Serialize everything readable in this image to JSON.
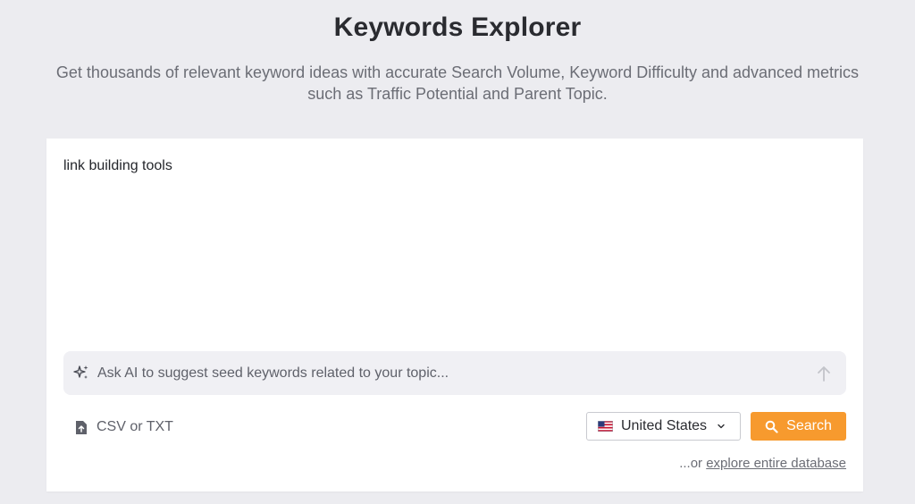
{
  "header": {
    "title": "Keywords Explorer",
    "subtitle": "Get thousands of relevant keyword ideas with accurate Search Volume, Keyword Difficulty and advanced metrics such as Traffic Potential and Parent Topic."
  },
  "keyword_input": {
    "value": "link building tools"
  },
  "ai_bar": {
    "placeholder": "Ask AI to suggest seed keywords related to your topic...",
    "icon": "sparkles-icon",
    "send_icon": "arrow-up-icon"
  },
  "upload": {
    "label": "CSV or TXT",
    "icon": "file-upload-icon"
  },
  "country_select": {
    "selected": "United States",
    "flag": "us-flag-icon"
  },
  "search_button": {
    "label": "Search",
    "color": "#f79a2e"
  },
  "explore": {
    "prefix": "...or ",
    "link": "explore entire database"
  }
}
